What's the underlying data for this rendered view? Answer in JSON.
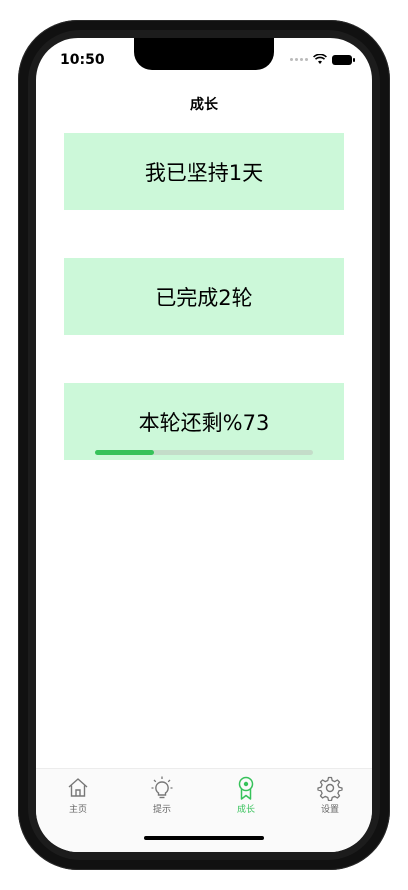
{
  "status_bar": {
    "time": "10:50"
  },
  "nav": {
    "title": "成长"
  },
  "cards": {
    "days": "我已坚持1天",
    "rounds": "已完成2轮",
    "remaining": "本轮还剩%73"
  },
  "progress": {
    "fraction": 0.27
  },
  "tabbar": {
    "items": [
      {
        "label": "主页",
        "icon": "home-icon"
      },
      {
        "label": "提示",
        "icon": "lightbulb-icon"
      },
      {
        "label": "成长",
        "icon": "badge-icon"
      },
      {
        "label": "设置",
        "icon": "gear-icon"
      }
    ],
    "active_index": 2
  },
  "colors": {
    "accent": "#36c25a",
    "card_bg": "#ccf8d9",
    "track": "#c4dcc9"
  }
}
